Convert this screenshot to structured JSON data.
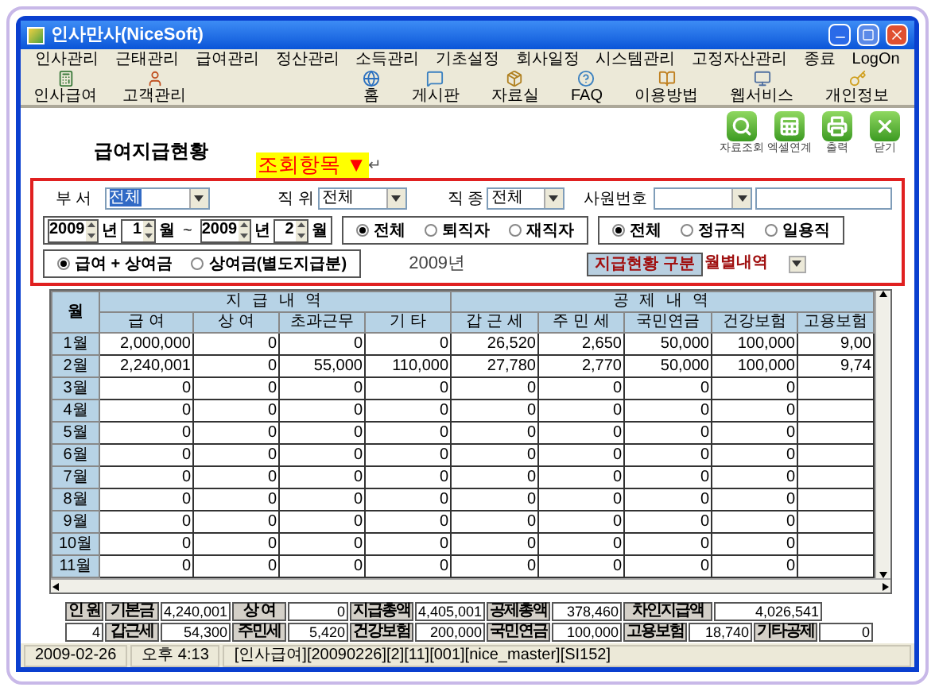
{
  "window": {
    "title": "인사만사(NiceSoft)"
  },
  "menu": [
    "인사관리",
    "근태관리",
    "급여관리",
    "정산관리",
    "소득관리",
    "기초설정",
    "회사일정",
    "시스템관리",
    "고정자산관리",
    "종료",
    "LogOn"
  ],
  "toolbar_left": [
    {
      "kind": "calc",
      "label": "인사급여"
    },
    {
      "kind": "person",
      "label": "고객관리"
    }
  ],
  "toolbar_right": [
    {
      "kind": "globe",
      "label": "홈"
    },
    {
      "kind": "board",
      "label": "게시판"
    },
    {
      "kind": "box",
      "label": "자료실"
    },
    {
      "kind": "faq",
      "label": "FAQ"
    },
    {
      "kind": "guide",
      "label": "이용방법"
    },
    {
      "kind": "monitor",
      "label": "웹서비스"
    },
    {
      "kind": "key",
      "label": "개인정보"
    }
  ],
  "page_title": "급여지급현황",
  "query_label": {
    "text": "조회항목",
    "arrow": "▼",
    "return_mark": "↵"
  },
  "actions": [
    {
      "kind": "search",
      "label": "자료조회"
    },
    {
      "kind": "excel",
      "label": "엑셀연계"
    },
    {
      "kind": "print",
      "label": "출력"
    },
    {
      "kind": "close",
      "label": "닫기"
    }
  ],
  "filters": {
    "department": {
      "label": "부 서",
      "value": "전체"
    },
    "position": {
      "label": "직 위",
      "value": "전체"
    },
    "job_type": {
      "label": "직 종",
      "value": "전체"
    },
    "employee_no": {
      "label": "사원번호"
    }
  },
  "period": {
    "from_year": "2009",
    "year_unit_1": "년",
    "from_month": "1",
    "month_unit_1": "월",
    "separator": "~",
    "to_year": "2009",
    "year_unit_2": "년",
    "to_month": "2",
    "month_unit_2": "월"
  },
  "status_radios": [
    {
      "label": "전체",
      "selected": true
    },
    {
      "label": "퇴직자",
      "selected": false
    },
    {
      "label": "재직자",
      "selected": false
    }
  ],
  "type_radios": [
    {
      "label": "전체",
      "selected": true
    },
    {
      "label": "정규직",
      "selected": false
    },
    {
      "label": "일용직",
      "selected": false
    }
  ],
  "pay_radios": [
    {
      "label": "급여 + 상여금",
      "selected": true
    },
    {
      "label": "상여금(별도지급분)",
      "selected": false
    }
  ],
  "year_label": "2009년",
  "payment_type": {
    "label": "지급현황 구분",
    "value": "월별내역"
  },
  "table": {
    "month_header": "월",
    "groups": [
      {
        "label": "지 급 내 역"
      },
      {
        "label": "공 제 내 역"
      }
    ],
    "columns": [
      "급 여",
      "상 여",
      "초과근무",
      "기 타",
      "갑 근 세",
      "주 민 세",
      "국민연금",
      "건강보험",
      "고용보험"
    ],
    "rows": [
      {
        "month": "1월",
        "cells": [
          "2,000,000",
          "0",
          "0",
          "0",
          "26,520",
          "2,650",
          "50,000",
          "100,000",
          "9,00"
        ]
      },
      {
        "month": "2월",
        "cells": [
          "2,240,001",
          "0",
          "55,000",
          "110,000",
          "27,780",
          "2,770",
          "50,000",
          "100,000",
          "9,74"
        ]
      },
      {
        "month": "3월",
        "cells": [
          "0",
          "0",
          "0",
          "0",
          "0",
          "0",
          "0",
          "0"
        ]
      },
      {
        "month": "4월",
        "cells": [
          "0",
          "0",
          "0",
          "0",
          "0",
          "0",
          "0",
          "0"
        ]
      },
      {
        "month": "5월",
        "cells": [
          "0",
          "0",
          "0",
          "0",
          "0",
          "0",
          "0",
          "0"
        ]
      },
      {
        "month": "6월",
        "cells": [
          "0",
          "0",
          "0",
          "0",
          "0",
          "0",
          "0",
          "0"
        ]
      },
      {
        "month": "7월",
        "cells": [
          "0",
          "0",
          "0",
          "0",
          "0",
          "0",
          "0",
          "0"
        ]
      },
      {
        "month": "8월",
        "cells": [
          "0",
          "0",
          "0",
          "0",
          "0",
          "0",
          "0",
          "0"
        ]
      },
      {
        "month": "9월",
        "cells": [
          "0",
          "0",
          "0",
          "0",
          "0",
          "0",
          "0",
          "0"
        ]
      },
      {
        "month": "10월",
        "cells": [
          "0",
          "0",
          "0",
          "0",
          "0",
          "0",
          "0",
          "0"
        ]
      },
      {
        "month": "11월",
        "cells": [
          "0",
          "0",
          "0",
          "0",
          "0",
          "0",
          "0",
          "0"
        ]
      }
    ]
  },
  "summary": [
    [
      {
        "kind": "label",
        "text": "인 원"
      },
      {
        "kind": "label",
        "text": "기본금"
      },
      {
        "kind": "value",
        "text": "4,240,001"
      },
      {
        "kind": "label",
        "text": "상 여"
      },
      {
        "kind": "value",
        "text": "0"
      },
      {
        "kind": "label",
        "text": "지급총액"
      },
      {
        "kind": "value",
        "text": "4,405,001"
      },
      {
        "kind": "label",
        "text": "공제총액"
      },
      {
        "kind": "value",
        "text": "378,460"
      },
      {
        "kind": "label",
        "text": "차인지급액"
      },
      {
        "kind": "value",
        "text": "4,026,541"
      }
    ],
    [
      {
        "kind": "value",
        "text": "4"
      },
      {
        "kind": "label",
        "text": "갑근세"
      },
      {
        "kind": "value",
        "text": "54,300"
      },
      {
        "kind": "label",
        "text": "주민세"
      },
      {
        "kind": "value",
        "text": "5,420"
      },
      {
        "kind": "label",
        "text": "건강보험"
      },
      {
        "kind": "value",
        "text": "200,000"
      },
      {
        "kind": "label",
        "text": "국민연금"
      },
      {
        "kind": "value",
        "text": "100,000"
      },
      {
        "kind": "label",
        "text": "고용보험"
      },
      {
        "kind": "value",
        "text": "18,740"
      },
      {
        "kind": "label",
        "text": "기타공제"
      },
      {
        "kind": "value",
        "text": "0"
      }
    ]
  ],
  "status_bar": [
    "2009-02-26",
    "오후 4:13",
    "[인사급여][20090226][2][11][001][nice_master][SI152]"
  ]
}
